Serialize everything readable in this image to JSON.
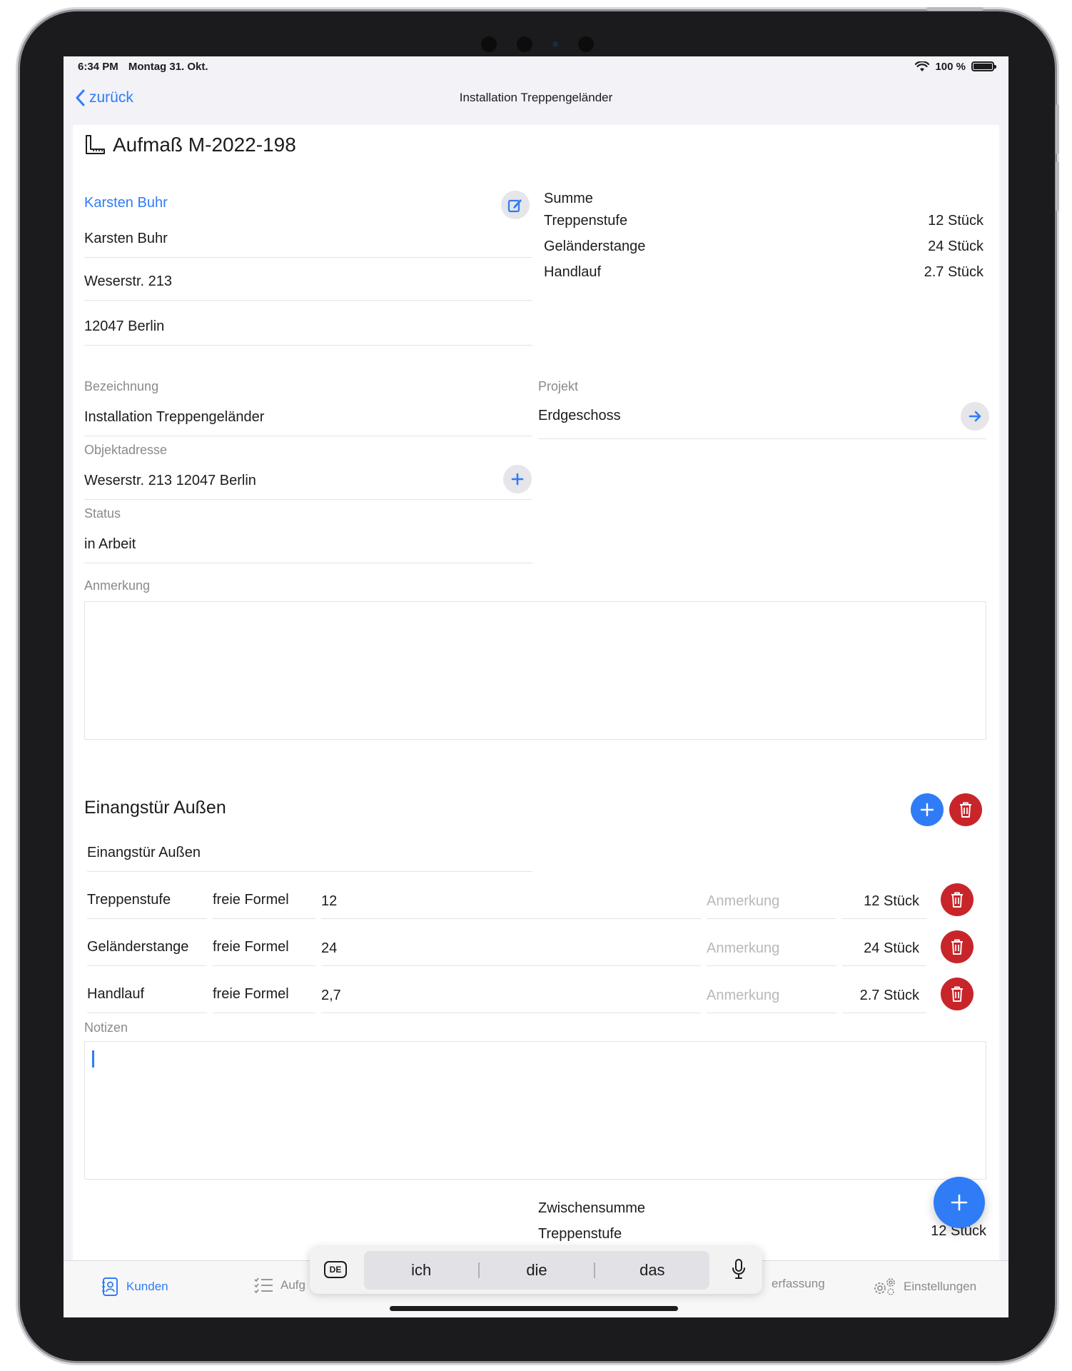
{
  "status_bar": {
    "time": "6:34 PM",
    "date": "Montag 31. Okt.",
    "battery": "100 %"
  },
  "nav": {
    "back_label": "zurück",
    "title": "Installation Treppengeländer"
  },
  "document": {
    "title": "Aufmaß M-2022-198"
  },
  "customer": {
    "link": "Karsten Buhr",
    "name": "Karsten Buhr",
    "street": "Weserstr. 213",
    "city": "12047 Berlin"
  },
  "summary": {
    "heading": "Summe",
    "rows": [
      {
        "label": "Treppenstufe",
        "value": "12 Stück"
      },
      {
        "label": "Geländerstange",
        "value": "24 Stück"
      },
      {
        "label": "Handlauf",
        "value": "2.7 Stück"
      }
    ]
  },
  "form": {
    "bezeichnung_label": "Bezeichnung",
    "bezeichnung_value": "Installation Treppengeländer",
    "projekt_label": "Projekt",
    "projekt_value": "Erdgeschoss",
    "objektadresse_label": "Objektadresse",
    "objektadresse_value": "Weserstr. 213 12047 Berlin",
    "status_label": "Status",
    "status_value": "in  Arbeit",
    "anmerkung_label": "Anmerkung"
  },
  "section": {
    "title": "Einangstür Außen",
    "name_value": "Einangstür Außen",
    "items": [
      {
        "name": "Treppenstufe",
        "formula": "freie Formel",
        "value": "12",
        "note_placeholder": "Anmerkung",
        "result": "12 Stück"
      },
      {
        "name": "Geländerstange",
        "formula": "freie Formel",
        "value": "24",
        "note_placeholder": "Anmerkung",
        "result": "24 Stück"
      },
      {
        "name": "Handlauf",
        "formula": "freie Formel",
        "value": "2,7",
        "note_placeholder": "Anmerkung",
        "result": "2.7 Stück"
      }
    ],
    "notes_label": "Notizen"
  },
  "subtotal": {
    "heading": "Zwischensumme",
    "row_label": "Treppenstufe",
    "row_value": "12 Stück"
  },
  "tabs": [
    {
      "label": "Kunden",
      "icon": "person-book-icon",
      "active": true
    },
    {
      "label": "Aufg",
      "icon": "checklist-icon",
      "active": false
    },
    {
      "label": "erfassung",
      "icon": "clock-icon",
      "active": false
    },
    {
      "label": "Einstellungen",
      "icon": "gears-icon",
      "active": false
    }
  ],
  "quicktype": {
    "language": "DE",
    "suggestions": [
      "ich",
      "die",
      "das"
    ]
  },
  "colors": {
    "accent": "#2f7cf6",
    "danger": "#c8252a",
    "divider": "#e3e3e8",
    "secondary_text": "#8a8a8e"
  }
}
